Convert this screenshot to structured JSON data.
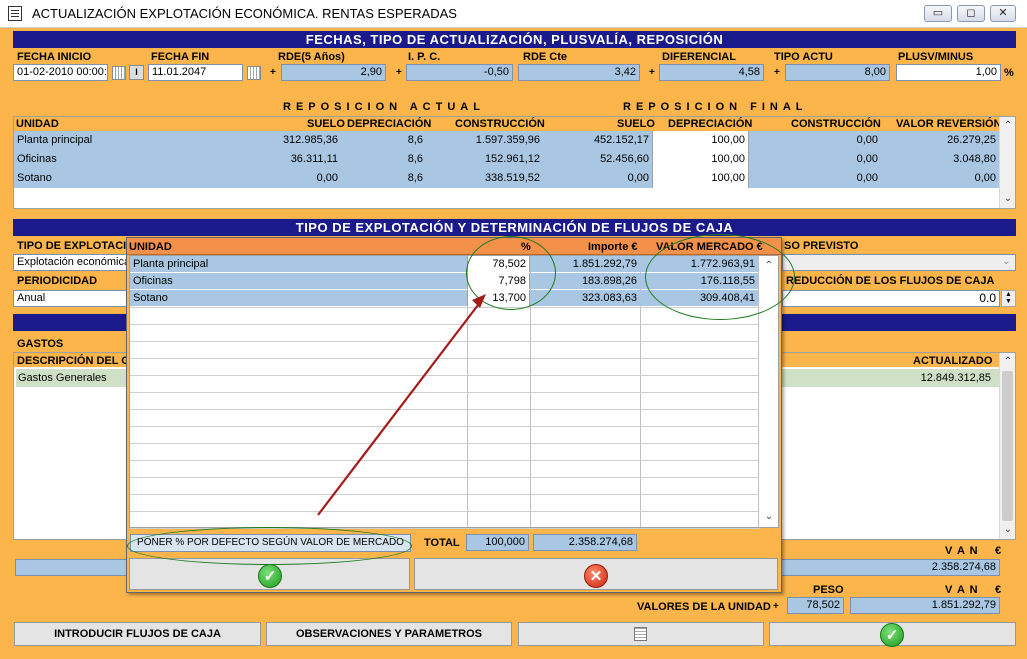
{
  "window": {
    "title": "ACTUALIZACIÓN EXPLOTACIÓN ECONÓMICA. RENTAS ESPERADAS",
    "controls": [
      "▭",
      "◻",
      "✕"
    ]
  },
  "section1": {
    "title": "FECHAS, TIPO DE ACTUALIZACIÓN, PLUSVALÍA, REPOSICIÓN",
    "fields": {
      "fecha_inicio": {
        "label": "FECHA  INICIO",
        "value": "01-02-2010 00:00:0"
      },
      "fecha_fin": {
        "label": "FECHA FIN",
        "value": "11.01.2047"
      },
      "rde5": {
        "label": "RDE(5 Años)",
        "value": "2,90"
      },
      "ipc": {
        "label": "I. P. C.",
        "value": "-0,50"
      },
      "rdecte": {
        "label": "RDE Cte",
        "value": "3,42"
      },
      "diferencial": {
        "label": "DIFERENCIAL",
        "value": "4,58"
      },
      "tipoactu": {
        "label": "TIPO ACTU",
        "value": "8,00"
      },
      "plusv": {
        "label": "PLUSV/MINUS",
        "value": "1,00",
        "unit": "%"
      }
    },
    "plus": "+",
    "ibtn": "I"
  },
  "reposicion": {
    "actual_label": "REPOSICION ACTUAL",
    "final_label": "REPOSICION FINAL",
    "columns": [
      "UNIDAD",
      "SUELO",
      "DEPRECIACIÓN",
      "CONSTRUCCIÓN",
      "SUELO",
      "DEPRECIACIÓN",
      "CONSTRUCCIÓN",
      "VALOR REVERSIÓN"
    ],
    "rows": [
      {
        "unidad": "Planta principal",
        "suelo": "312.985,36",
        "dep": "8,6",
        "cons": "1.597.359,96",
        "suelo_f": "452.152,17",
        "dep_f": "100,00",
        "cons_f": "0,00",
        "rev": "26.279,25"
      },
      {
        "unidad": "Oficinas",
        "suelo": "36.311,11",
        "dep": "8,6",
        "cons": "152.961,12",
        "suelo_f": "52.456,60",
        "dep_f": "100,00",
        "cons_f": "0,00",
        "rev": "3.048,80"
      },
      {
        "unidad": "Sotano",
        "suelo": "0,00",
        "dep": "8,6",
        "cons": "338.519,52",
        "suelo_f": "0,00",
        "dep_f": "100,00",
        "cons_f": "0,00",
        "rev": "0,00"
      }
    ]
  },
  "section2": {
    "title": "TIPO DE EXPLOTACIÓN Y DETERMINACIÓN DE FLUJOS DE CAJA",
    "tipo_label": "TIPO DE EXPLOTACIÓN",
    "tipo_value": "Explotación económica",
    "uso_label": "SO PREVISTO",
    "periodicidad_label": "PERIODICIDAD",
    "periodicidad_value": "Anual",
    "reduccion_label": "REDUCCIÓN DE LOS FLUJOS DE CAJA",
    "reduccion_value": "0.0",
    "gastos_label": "GASTOS",
    "desc_col": "DESCRIPCIÓN DEL GA",
    "actualizado_col": "ACTUALIZADO",
    "gastos_row": {
      "desc": "Gastos Generales",
      "actualizado": "12.849.312,85"
    }
  },
  "van": {
    "label1": "V A N",
    "cur1": "€",
    "value1": "2.358.274,68",
    "peso_label": "PESO",
    "label2": "V A N",
    "cur2": "€",
    "valores_label": "VALORES DE LA UNIDAD",
    "plus": "+",
    "peso_value": "78,502",
    "value2": "1.851.292,79"
  },
  "bottom_buttons": {
    "flujos": "INTRODUCIR FLUJOS DE CAJA",
    "obs": "OBSERVACIONES Y PARAMETROS"
  },
  "popup": {
    "columns": [
      "UNIDAD",
      "%",
      "Importe €",
      "VALOR MERCADO €"
    ],
    "rows": [
      {
        "unidad": "Planta principal",
        "pct": "78,502",
        "importe": "1.851.292,79",
        "valor": "1.772.963,91"
      },
      {
        "unidad": "Oficinas",
        "pct": "7,798",
        "importe": "183.898,26",
        "valor": "176.118,55"
      },
      {
        "unidad": "Sotano",
        "pct": "13,700",
        "importe": "323.083,63",
        "valor": "309.408,41"
      }
    ],
    "default_button": "PONER % POR DEFECTO SEGÚN VALOR DE MERCADO",
    "total_label": "TOTAL",
    "total_pct": "100,000",
    "total_importe": "2.358.274,68"
  }
}
